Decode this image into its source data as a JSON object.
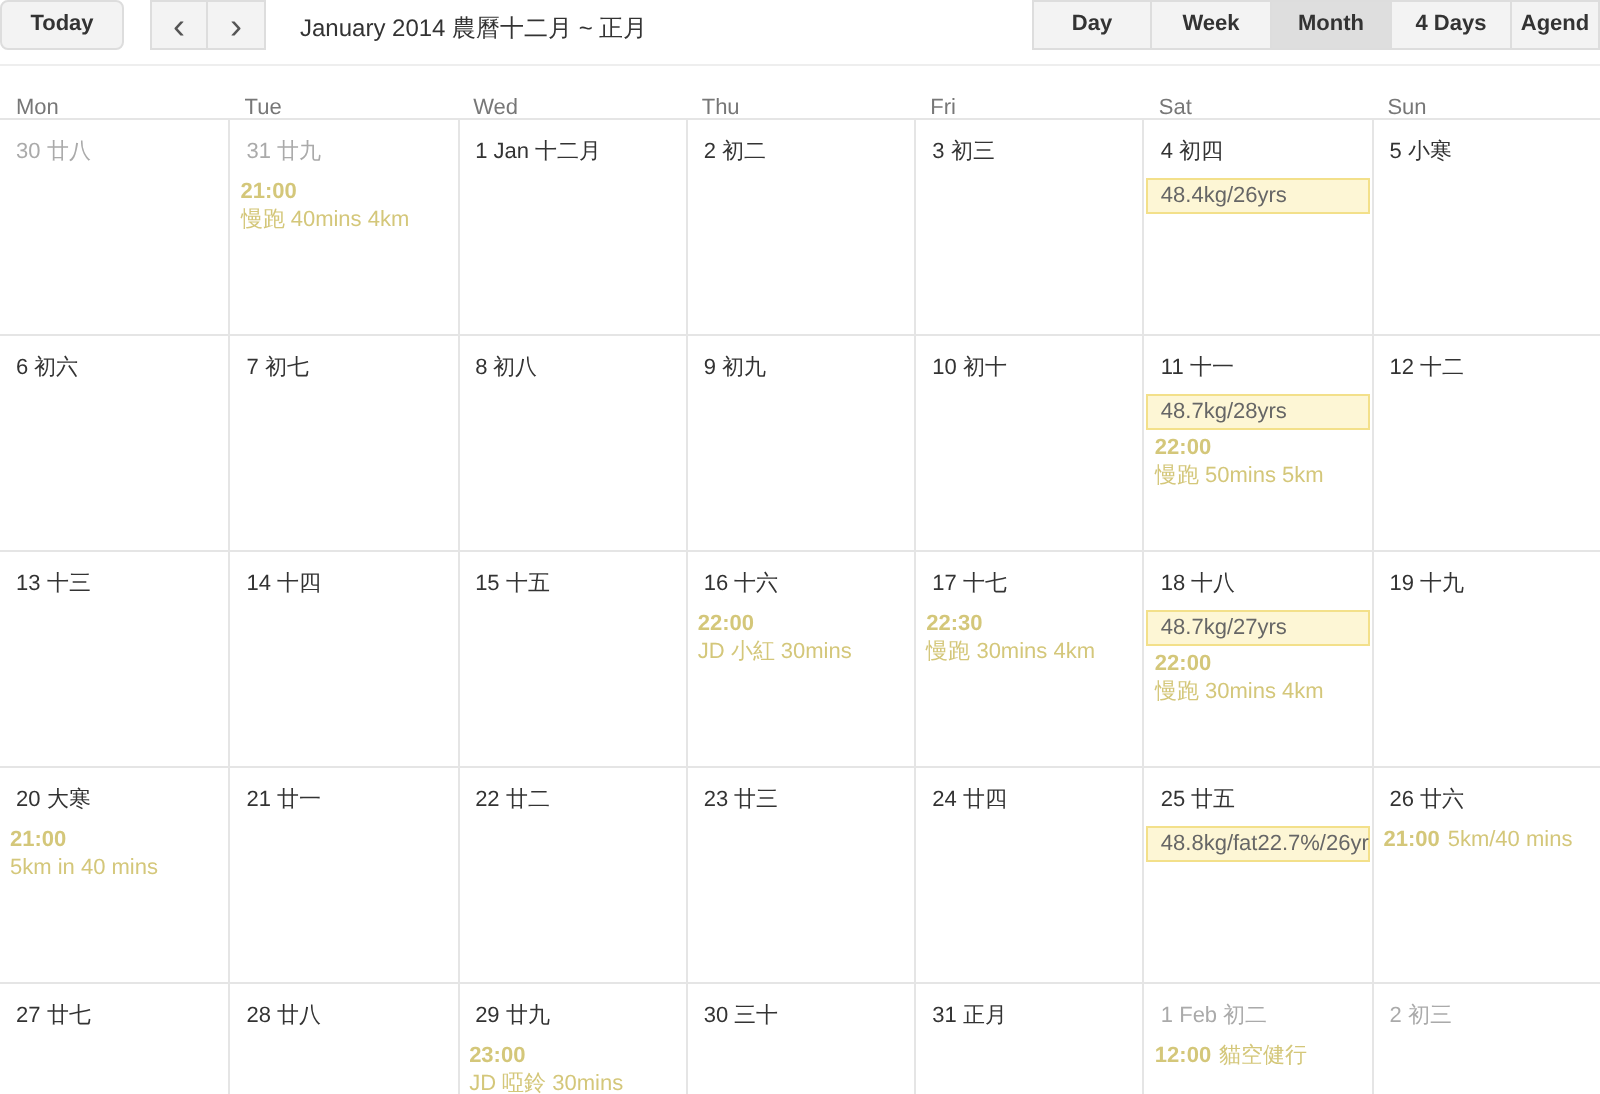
{
  "toolbar": {
    "today": "Today",
    "prev": "‹",
    "next": "›",
    "title": "January 2014 農曆十二月 ~ 正月",
    "views": [
      {
        "label": "Day",
        "selected": false
      },
      {
        "label": "Week",
        "selected": false
      },
      {
        "label": "Month",
        "selected": true
      },
      {
        "label": "4 Days",
        "selected": false
      },
      {
        "label": "Agend",
        "selected": false
      }
    ]
  },
  "weekdays": [
    "Mon",
    "Tue",
    "Wed",
    "Thu",
    "Fri",
    "Sat",
    "Sun"
  ],
  "weeks": [
    [
      {
        "label": "30 廿八",
        "muted": true
      },
      {
        "label": "31 廿九",
        "muted": true,
        "events": [
          {
            "kind": "timed",
            "time": "21:00",
            "title": "慢跑 40mins 4km"
          }
        ]
      },
      {
        "label": "1 Jan 十二月",
        "muted": false
      },
      {
        "label": "2 初二",
        "muted": false
      },
      {
        "label": "3 初三",
        "muted": false
      },
      {
        "label": "4 初四",
        "muted": false,
        "events": [
          {
            "kind": "allday",
            "title": "48.4kg/26yrs"
          }
        ]
      },
      {
        "label": "5 小寒",
        "muted": false
      }
    ],
    [
      {
        "label": "6 初六",
        "muted": false
      },
      {
        "label": "7 初七",
        "muted": false
      },
      {
        "label": "8 初八",
        "muted": false
      },
      {
        "label": "9 初九",
        "muted": false
      },
      {
        "label": "10 初十",
        "muted": false
      },
      {
        "label": "11 十一",
        "muted": false,
        "events": [
          {
            "kind": "allday",
            "title": "48.7kg/28yrs"
          },
          {
            "kind": "timed",
            "time": "22:00",
            "title": "慢跑 50mins 5km"
          }
        ]
      },
      {
        "label": "12 十二",
        "muted": false
      }
    ],
    [
      {
        "label": "13 十三",
        "muted": false
      },
      {
        "label": "14 十四",
        "muted": false
      },
      {
        "label": "15 十五",
        "muted": false
      },
      {
        "label": "16 十六",
        "muted": false,
        "events": [
          {
            "kind": "timed",
            "time": "22:00",
            "title": "JD 小紅 30mins"
          }
        ]
      },
      {
        "label": "17 十七",
        "muted": false,
        "events": [
          {
            "kind": "timed",
            "time": "22:30",
            "title": "慢跑 30mins 4km"
          }
        ]
      },
      {
        "label": "18 十八",
        "muted": false,
        "events": [
          {
            "kind": "allday",
            "title": "48.7kg/27yrs"
          },
          {
            "kind": "timed",
            "time": "22:00",
            "title": "慢跑 30mins 4km"
          }
        ]
      },
      {
        "label": "19 十九",
        "muted": false
      }
    ],
    [
      {
        "label": "20 大寒",
        "muted": false,
        "events": [
          {
            "kind": "timed",
            "time": "21:00",
            "title": "5km in 40 mins"
          }
        ]
      },
      {
        "label": "21 廿一",
        "muted": false
      },
      {
        "label": "22 廿二",
        "muted": false
      },
      {
        "label": "23 廿三",
        "muted": false
      },
      {
        "label": "24 廿四",
        "muted": false
      },
      {
        "label": "25 廿五",
        "muted": false,
        "events": [
          {
            "kind": "allday",
            "title": "48.8kg/fat22.7%/26yr"
          }
        ]
      },
      {
        "label": "26 廿六",
        "muted": false,
        "events": [
          {
            "kind": "timed",
            "time": "21:00",
            "title": "5km/40 mins"
          }
        ]
      }
    ],
    [
      {
        "label": "27 廿七",
        "muted": false
      },
      {
        "label": "28 廿八",
        "muted": false
      },
      {
        "label": "29 廿九",
        "muted": false,
        "events": [
          {
            "kind": "timed",
            "time": "23:00",
            "title": "JD 啞鈴 30mins"
          }
        ]
      },
      {
        "label": "30 三十",
        "muted": false
      },
      {
        "label": "31 正月",
        "muted": false
      },
      {
        "label": "1 Feb 初二",
        "muted": true,
        "events": [
          {
            "kind": "timed",
            "time": "12:00",
            "title": "貓空健行"
          }
        ]
      },
      {
        "label": "2 初三",
        "muted": true
      }
    ]
  ]
}
